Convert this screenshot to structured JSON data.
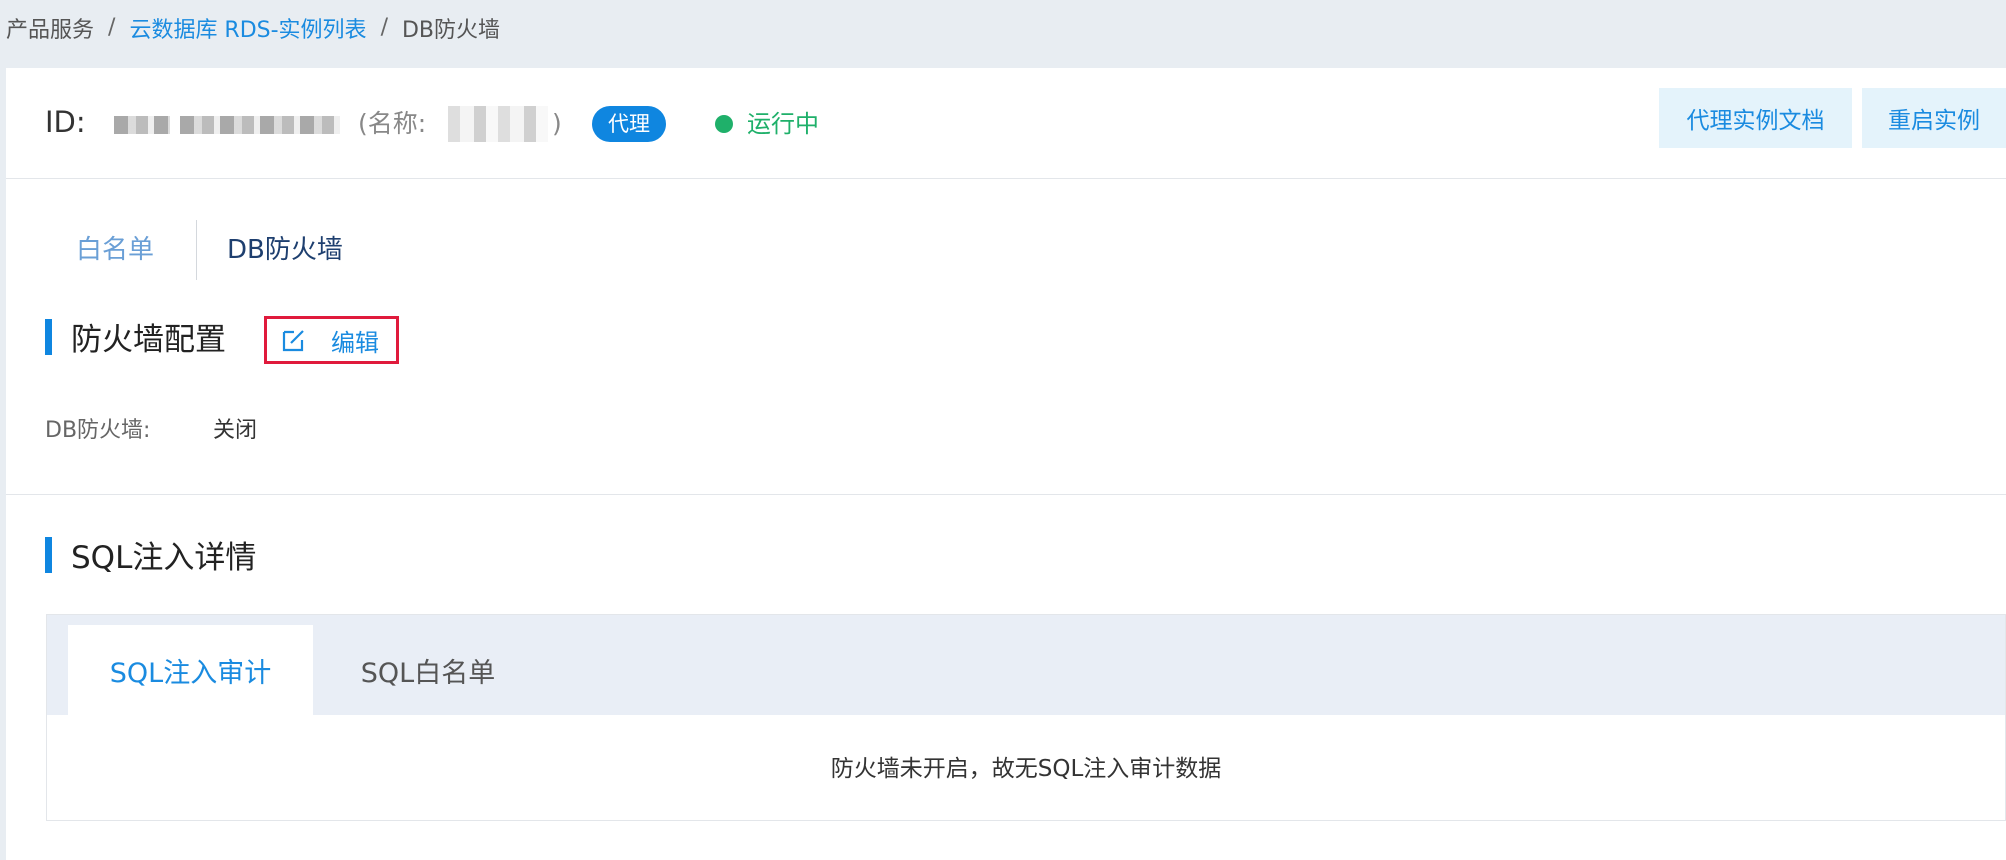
{
  "breadcrumb": {
    "items": [
      {
        "label": "产品服务"
      },
      {
        "label": "云数据库 RDS-实例列表"
      },
      {
        "label": "DB防火墙"
      }
    ],
    "separator": "/"
  },
  "header": {
    "id_label": "ID:",
    "name_open": "(名称:",
    "name_close": ")",
    "badge": "代理",
    "status": "运行中",
    "buttons": {
      "doc": "代理实例文档",
      "restart": "重启实例"
    }
  },
  "tabs": [
    {
      "label": "白名单"
    },
    {
      "label": "DB防火墙"
    }
  ],
  "firewall": {
    "title": "防火墙配置",
    "edit_label": "编辑",
    "field_label": "DB防火墙:",
    "field_value": "关闭"
  },
  "sql": {
    "title": "SQL注入详情",
    "tabs": [
      {
        "label": "SQL注入审计"
      },
      {
        "label": "SQL白名单"
      }
    ],
    "empty_message": "防火墙未开启，故无SQL注入审计数据"
  },
  "colors": {
    "accent": "#0f86e0",
    "status_green": "#1fb06a",
    "highlight_red": "#e01a3c"
  }
}
